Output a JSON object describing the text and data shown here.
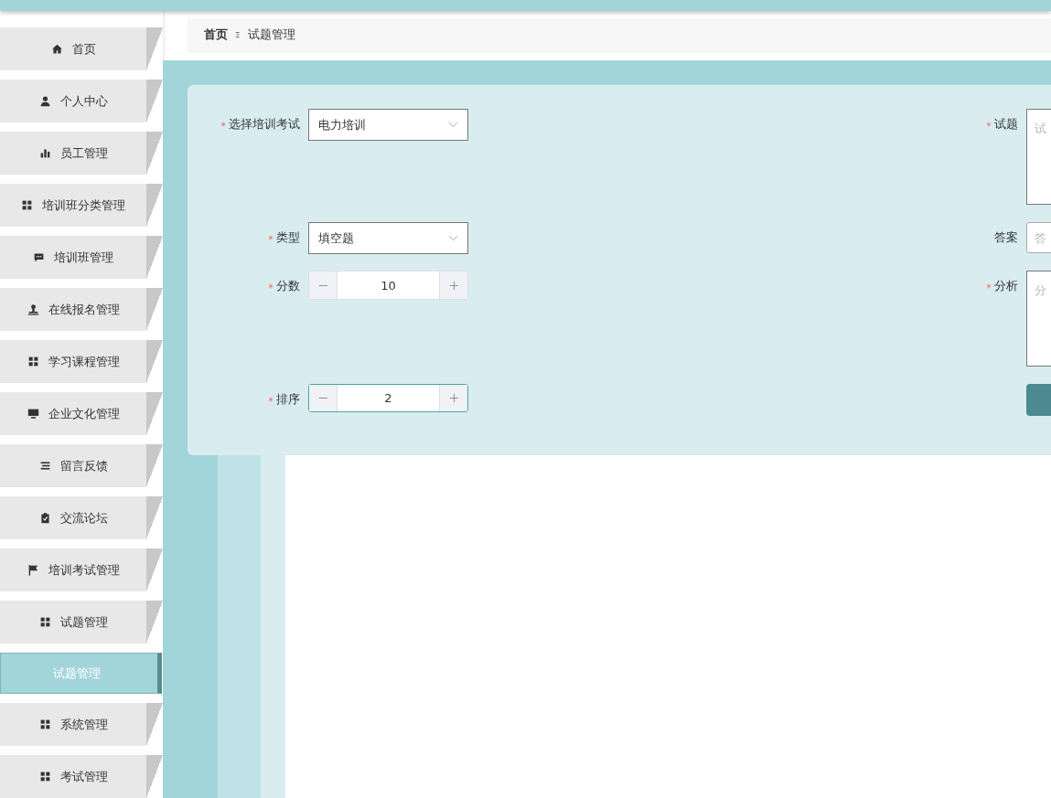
{
  "breadcrumb": [
    {
      "label": "首页"
    },
    {
      "label": "试题管理"
    }
  ],
  "sidebar": {
    "items": [
      {
        "label": "首页",
        "kind": "menu",
        "selected": false
      },
      {
        "label": "个人中心",
        "kind": "menu",
        "selected": false
      },
      {
        "label": "员工管理",
        "kind": "menu",
        "selected": false
      },
      {
        "label": "培训班分类管理",
        "kind": "menu",
        "selected": false
      },
      {
        "label": "培训班管理",
        "kind": "menu",
        "selected": false
      },
      {
        "label": "在线报名管理",
        "kind": "menu",
        "selected": false
      },
      {
        "label": "学习课程管理",
        "kind": "menu",
        "selected": false
      },
      {
        "label": "企业文化管理",
        "kind": "menu",
        "selected": false
      },
      {
        "label": "留言反馈",
        "kind": "menu",
        "selected": false
      },
      {
        "label": "交流论坛",
        "kind": "menu",
        "selected": false
      },
      {
        "label": "培训考试管理",
        "kind": "menu",
        "selected": false
      },
      {
        "label": "试题管理",
        "kind": "menu",
        "selected": false
      },
      {
        "label": "试题管理",
        "kind": "submenu",
        "selected": true
      },
      {
        "label": "系统管理",
        "kind": "menu",
        "selected": false
      },
      {
        "label": "考试管理",
        "kind": "menu",
        "selected": false
      }
    ]
  },
  "form": {
    "rows": [
      {
        "left": {
          "label": "选择培训考试",
          "required": true,
          "kind": "select",
          "value": "电力培训"
        },
        "right": {
          "label": "试题",
          "required": true,
          "kind": "textarea",
          "placeholder": "试"
        }
      },
      {
        "left": {
          "label": "类型",
          "required": true,
          "kind": "select",
          "value": "填空题"
        },
        "right": {
          "label": "答案",
          "required": false,
          "kind": "input",
          "placeholder": "答"
        }
      },
      {
        "left": {
          "label": "分数",
          "required": true,
          "kind": "number",
          "value": "10",
          "focused": false
        },
        "right": {
          "label": "分析",
          "required": true,
          "kind": "textarea",
          "placeholder": "分"
        }
      },
      {
        "left": {
          "label": "排序",
          "required": true,
          "kind": "number",
          "value": "2",
          "focused": true
        },
        "right": {
          "kind": "button"
        }
      }
    ]
  }
}
